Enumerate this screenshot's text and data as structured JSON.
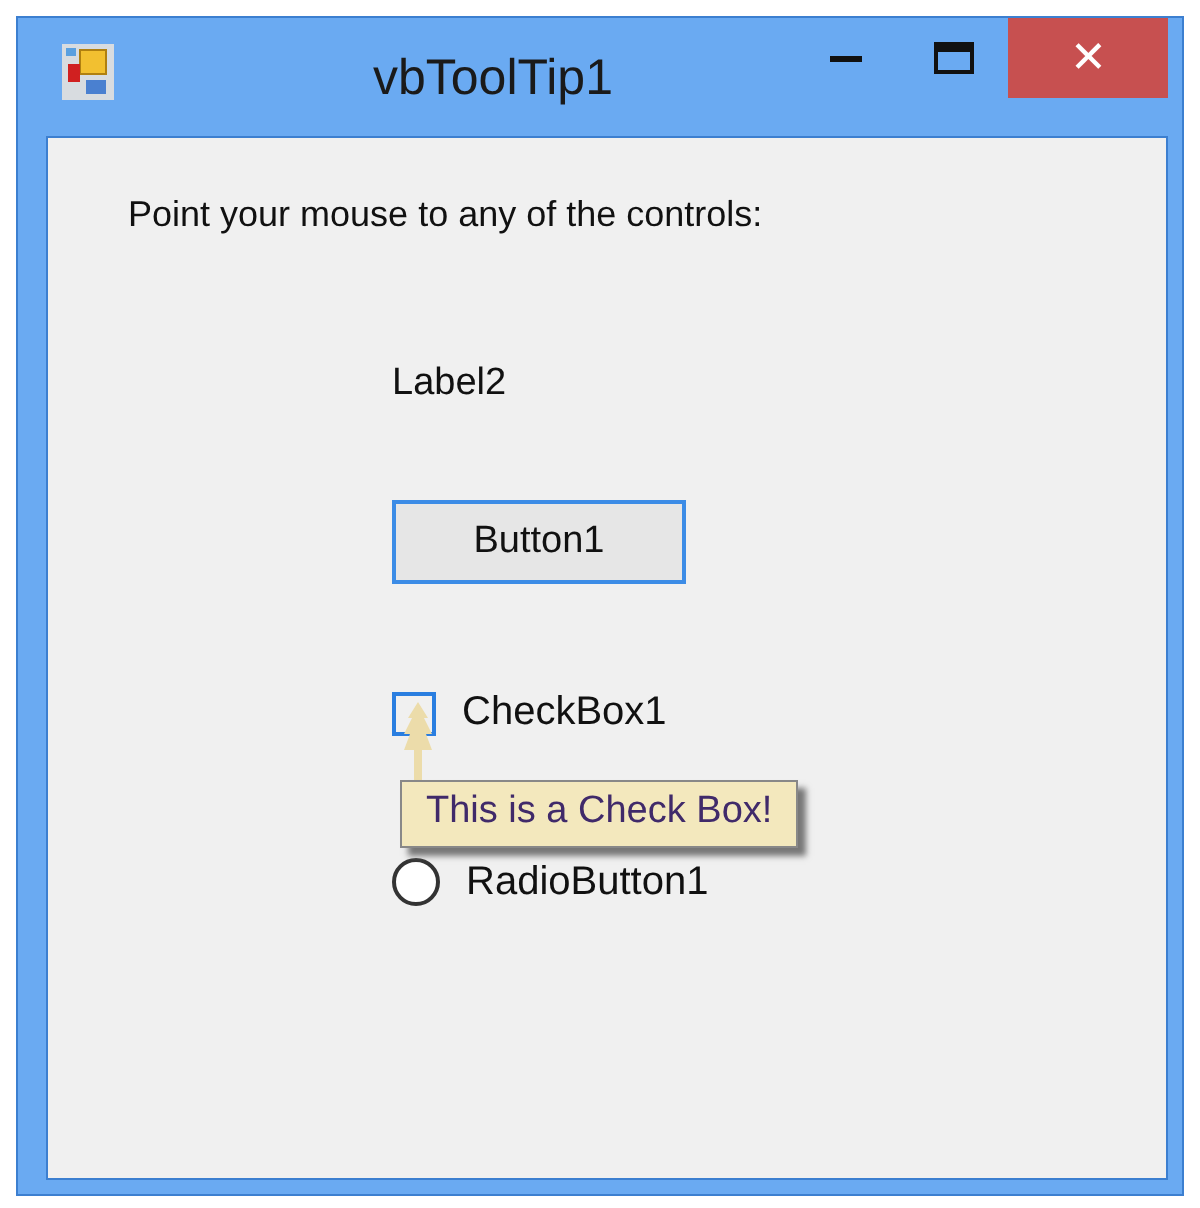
{
  "window": {
    "title": "vbToolTip1"
  },
  "instruction": "Point your mouse to any of the controls:",
  "label": "Label2",
  "button": {
    "label": "Button1"
  },
  "checkbox": {
    "label": "CheckBox1",
    "checked": false
  },
  "radio": {
    "label": "RadioButton1",
    "selected": false
  },
  "tooltip": {
    "text": "This is a Check Box!"
  },
  "title_buttons": {
    "close": "✕"
  }
}
